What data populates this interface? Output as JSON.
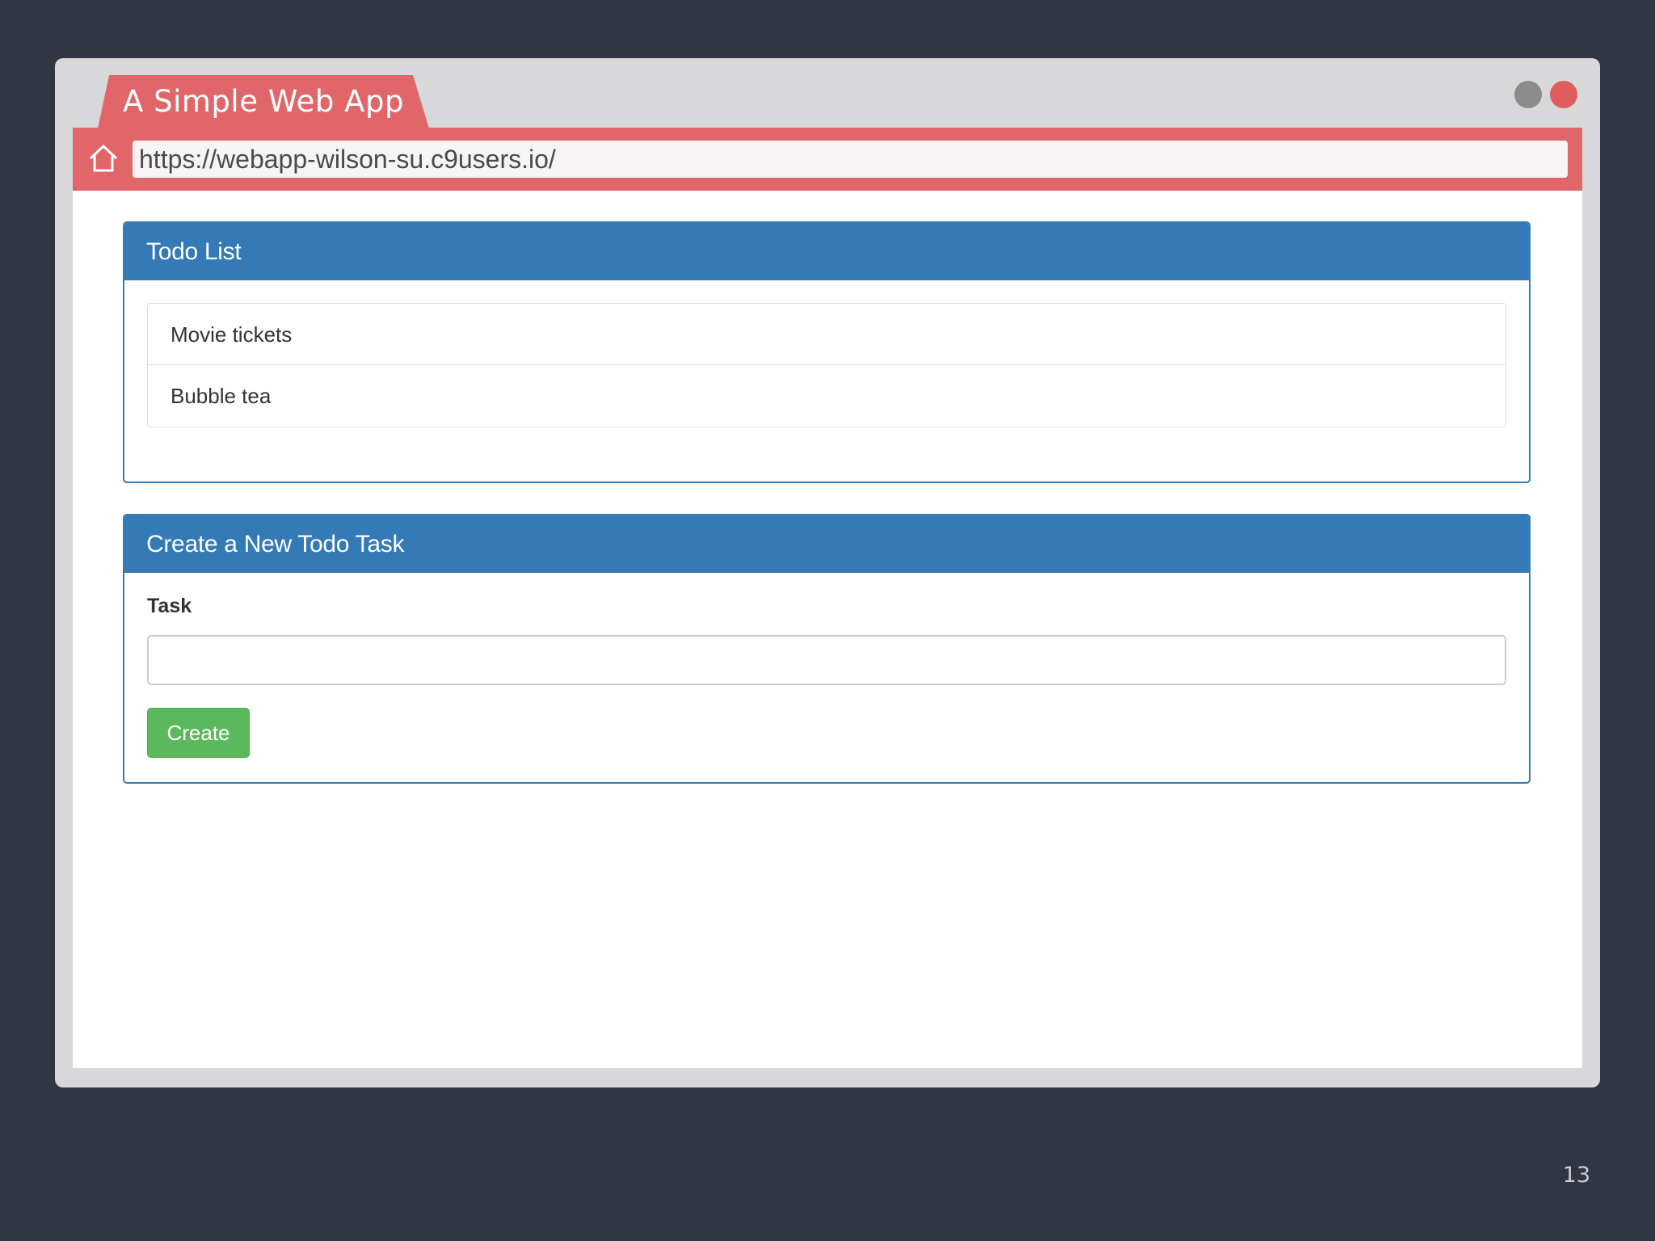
{
  "browser": {
    "tab_title": "A Simple Web App",
    "url": "https://webapp-wilson-su.c9users.io/"
  },
  "todo_panel": {
    "heading": "Todo List",
    "items": [
      {
        "label": "Movie tickets"
      },
      {
        "label": "Bubble tea"
      }
    ]
  },
  "create_panel": {
    "heading": "Create a New Todo Task",
    "task_label": "Task",
    "task_value": "",
    "create_label": "Create"
  },
  "slide": {
    "page_number": "13"
  },
  "colors": {
    "background": "#323643",
    "browser_accent": "#e06669",
    "panel_primary": "#337ab7",
    "button_success": "#5cb85c"
  },
  "icons": {
    "home": "home-icon",
    "window_minimize": "window-dot-grey",
    "window_close": "window-dot-red"
  }
}
